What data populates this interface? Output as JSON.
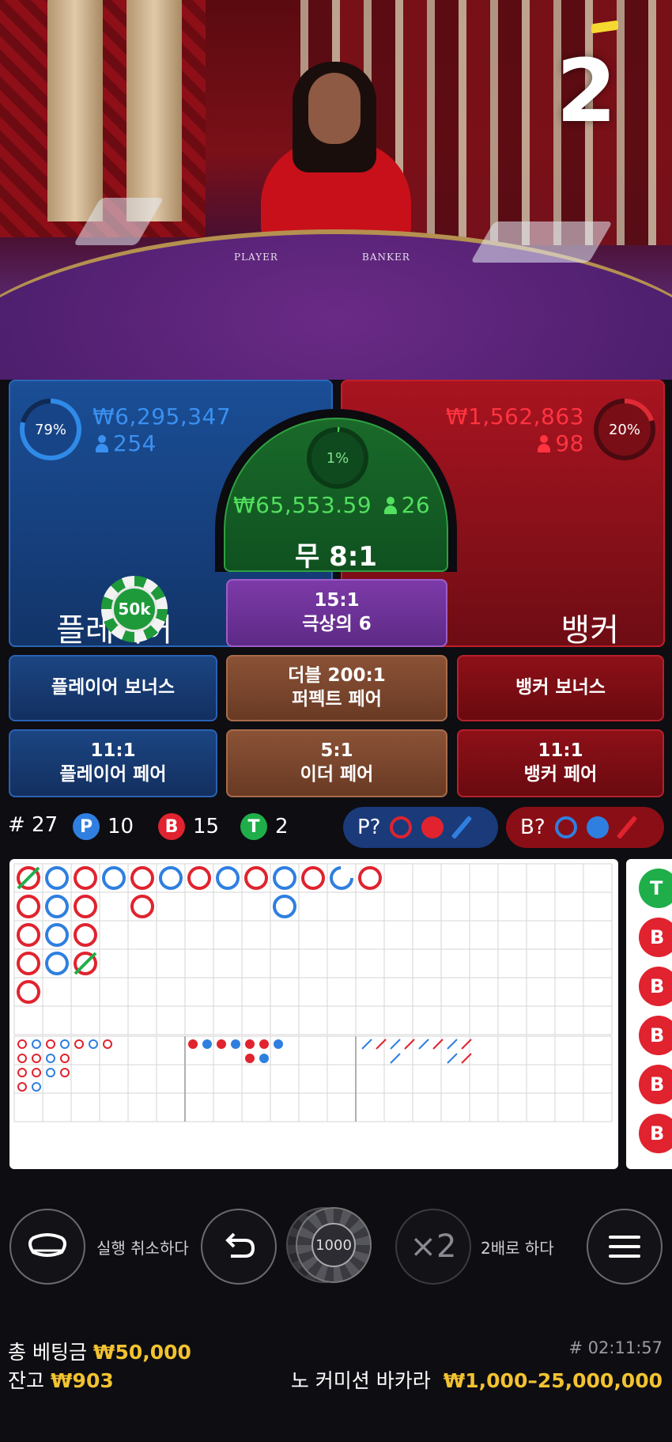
{
  "video": {
    "countdown": "2",
    "table_labels": {
      "player": "PLAYER",
      "banker": "BANKER"
    }
  },
  "player": {
    "percent": "79%",
    "amount": "₩6,295,347",
    "bettors": "254",
    "label": "플레이어",
    "chip": "50k"
  },
  "banker": {
    "percent": "20%",
    "amount": "₩1,562,863",
    "bettors": "98",
    "label": "뱅커"
  },
  "tie": {
    "percent": "1%",
    "amount": "₩65,553.59",
    "bettors": "26",
    "label": "무 8:1"
  },
  "side_bets": {
    "super6": {
      "odds": "15:1",
      "label": "극상의 6"
    },
    "player_bonus": "플레이어 보너스",
    "perfect_pair": {
      "odds": "더블 200:1",
      "label": "퍼펙트 페어"
    },
    "banker_bonus": "뱅커 보너스",
    "player_pair": {
      "odds": "11:1",
      "label": "플레이어 페어"
    },
    "either_pair": {
      "odds": "5:1",
      "label": "이더 페어"
    },
    "banker_pair": {
      "odds": "11:1",
      "label": "뱅커 페어"
    }
  },
  "stats": {
    "round": "# 27",
    "p_badge": "P",
    "p_count": "10",
    "b_badge": "B",
    "b_count": "15",
    "t_badge": "T",
    "t_count": "2",
    "player_predict": "P?",
    "banker_predict": "B?"
  },
  "road": {
    "big_road": [
      [
        {
          "c": "R",
          "tie": true
        },
        "R",
        "R",
        "R",
        "R"
      ],
      [
        "B",
        "B",
        "B",
        "B"
      ],
      [
        "R",
        "R",
        "R",
        {
          "c": "R",
          "tie": true
        }
      ],
      [
        "B"
      ],
      [
        "R",
        "R"
      ],
      [
        "B"
      ],
      [
        "R"
      ],
      [
        "B"
      ],
      [
        "R"
      ],
      [
        "B",
        "B"
      ],
      [
        "R"
      ],
      [
        {
          "c": "B",
          "partial": true
        }
      ],
      [
        "R"
      ]
    ],
    "side_items": [
      "T",
      "B",
      "B",
      "B",
      "B",
      "B"
    ]
  },
  "controls": {
    "undo_label": "실행 취소하다",
    "chip_value": "1000",
    "double_icon": "×2",
    "double_label": "2배로 하다"
  },
  "footer": {
    "total_bet_label": "총 베팅금",
    "total_bet": "₩50,000",
    "balance_label": "잔고",
    "balance": "₩903",
    "game_id": "# 02:11:57",
    "game_name": "노 커미션 바카라",
    "limits": "₩1,000–25,000,000"
  },
  "colors": {
    "player_blue": "#2f7fe0",
    "banker_red": "#e0232e",
    "tie_green": "#1fae4a",
    "gold": "#f2c230"
  }
}
